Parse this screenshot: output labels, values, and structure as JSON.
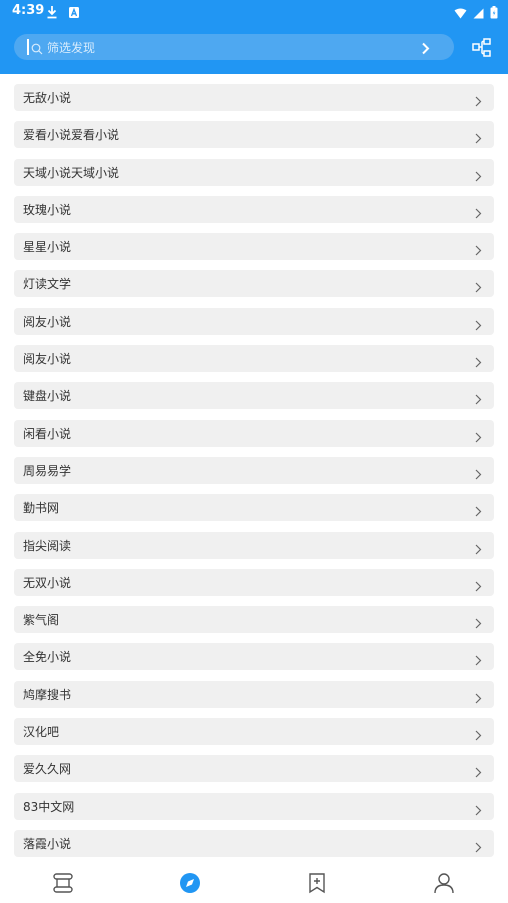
{
  "status_bar": {
    "time": "4:39"
  },
  "search": {
    "placeholder": "筛选发现",
    "value": ""
  },
  "sources": [
    "无敌小说",
    "爱看小说爱看小说",
    "天域小说天域小说",
    "玫瑰小说",
    "星星小说",
    "灯读文学",
    "阅友小说",
    "阅友小说",
    "键盘小说",
    "闲看小说",
    "周易易学",
    "勤书网",
    "指尖阅读",
    "无双小说",
    "紫气阁",
    "全免小说",
    "鸠摩搜书",
    "汉化吧",
    "爱久久网",
    "83中文网",
    "落霞小说"
  ],
  "colors": {
    "accent": "#2196f3",
    "item_bg": "#f0f0f0",
    "nav_active": "#2196f3",
    "nav_inactive": "#555555"
  },
  "bottom_nav": {
    "items": [
      {
        "icon": "bookshelf-icon",
        "active": false
      },
      {
        "icon": "discover-compass-icon",
        "active": true
      },
      {
        "icon": "bookmark-add-icon",
        "active": false
      },
      {
        "icon": "profile-icon",
        "active": false
      }
    ]
  }
}
